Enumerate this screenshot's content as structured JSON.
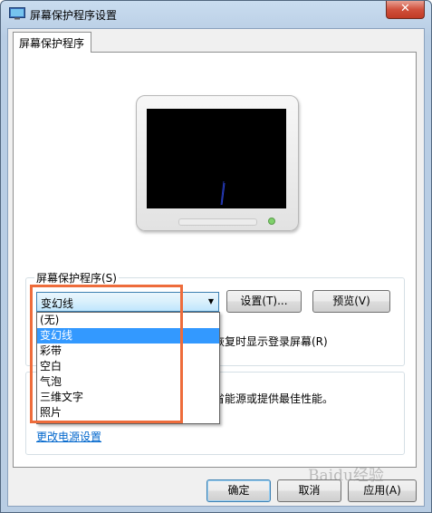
{
  "window": {
    "title": "屏幕保护程序设置",
    "close_label": "✕"
  },
  "tab": {
    "label": "屏幕保护程序"
  },
  "screensaver_group": {
    "label": "屏幕保护程序(S)",
    "selected_value": "变幻线",
    "settings_button": "设置(T)...",
    "preview_button": "预览(V)",
    "resume_text": "恢复时显示登录屏幕(R)"
  },
  "dropdown": {
    "options": [
      "(无)",
      "变幻线",
      "彩带",
      "空白",
      "气泡",
      "三维文字",
      "照片"
    ],
    "selected_index": 1
  },
  "power_group": {
    "description": "省能源或提供最佳性能。",
    "link": "更改电源设置"
  },
  "footer": {
    "ok": "确定",
    "cancel": "取消",
    "apply": "应用(A)"
  },
  "watermark": "Baidu经验",
  "colors": {
    "highlight_border": "#ee6c3b",
    "selection": "#3399ff",
    "link": "#0066cc"
  }
}
